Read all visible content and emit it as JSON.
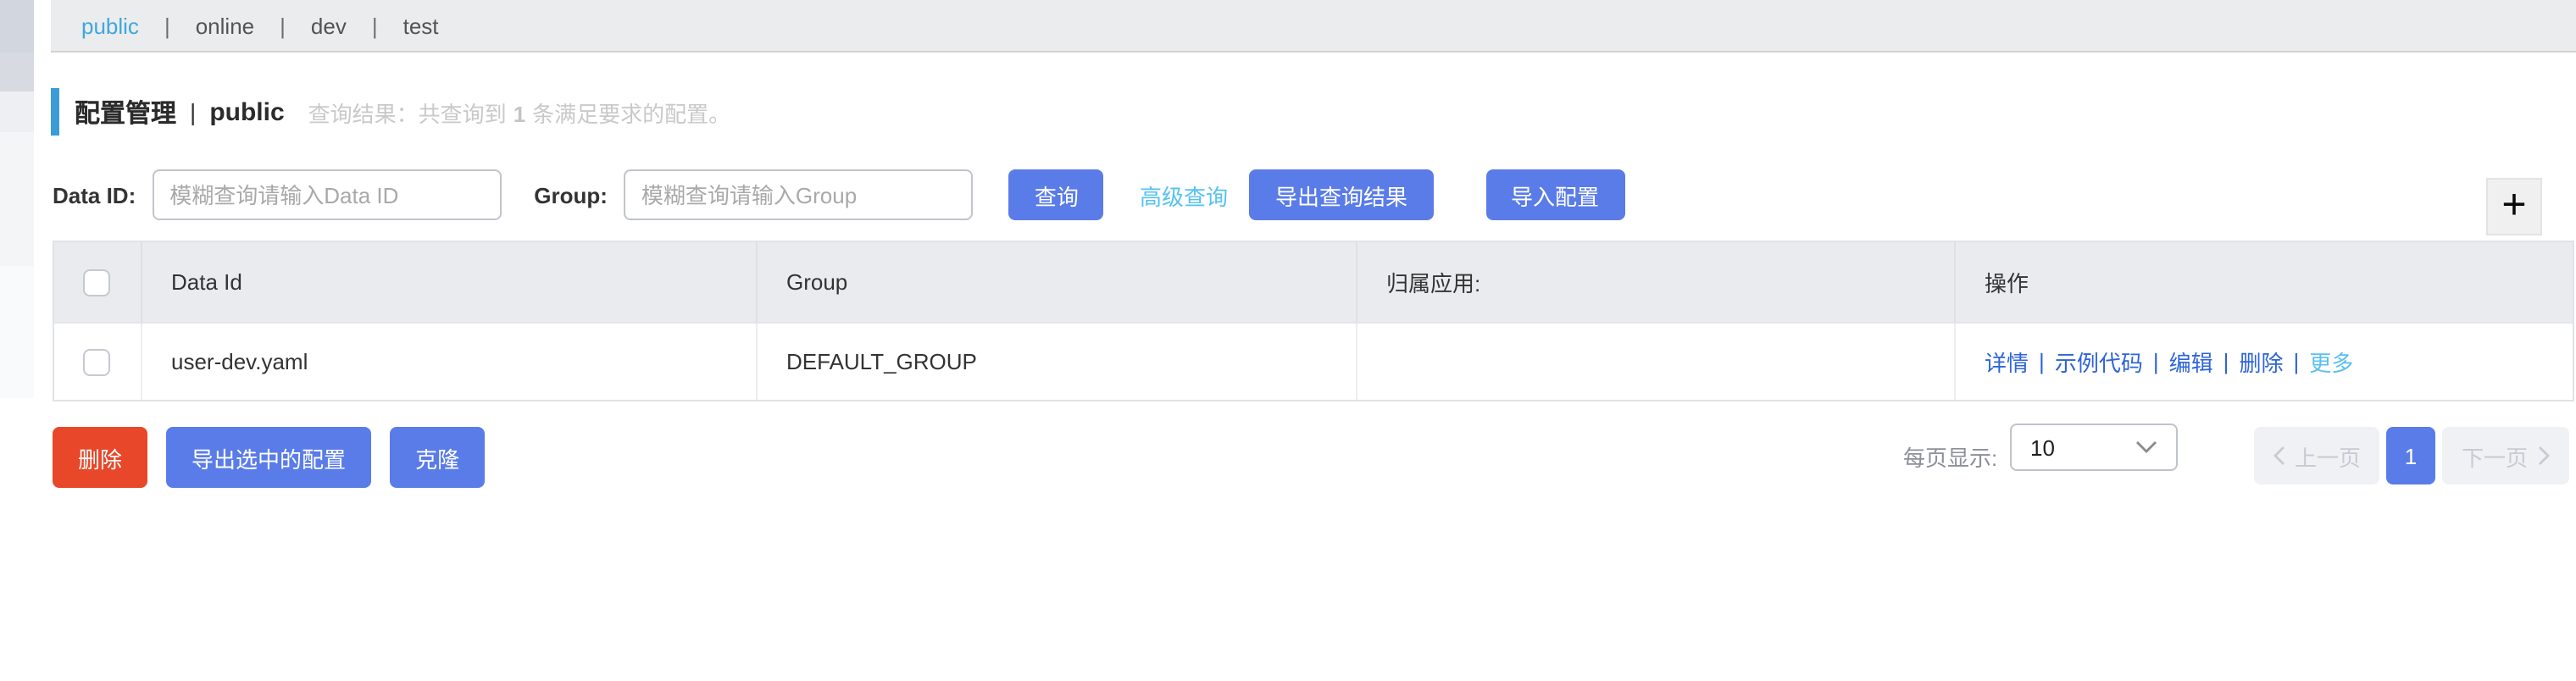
{
  "namespace_tabs": {
    "separator": "|",
    "items": [
      {
        "label": "public",
        "active": true
      },
      {
        "label": "online",
        "active": false
      },
      {
        "label": "dev",
        "active": false
      },
      {
        "label": "test",
        "active": false
      }
    ]
  },
  "header": {
    "title": "配置管理",
    "separator": "|",
    "namespace": "public",
    "result_prefix": "查询结果：共查询到",
    "result_count": "1",
    "result_suffix": "条满足要求的配置。"
  },
  "search_form": {
    "data_id_label": "Data ID:",
    "data_id_value": "",
    "data_id_placeholder": "模糊查询请输入Data ID",
    "group_label": "Group:",
    "group_value": "",
    "group_placeholder": "模糊查询请输入Group",
    "query_button": "查询",
    "advanced_query_link": "高级查询",
    "export_button": "导出查询结果",
    "import_button": "导入配置",
    "add_icon": "+"
  },
  "table": {
    "headers": [
      "",
      "Data Id",
      "Group",
      "归属应用:",
      "操作"
    ],
    "action_separator": "|",
    "rows": [
      {
        "data_id": "user-dev.yaml",
        "group": "DEFAULT_GROUP",
        "app": "",
        "actions": [
          "详情",
          "示例代码",
          "编辑",
          "删除",
          "更多"
        ]
      }
    ]
  },
  "footer": {
    "delete_button": "删除",
    "export_selected_button": "导出选中的配置",
    "clone_button": "克隆",
    "page_size_label": "每页显示:",
    "page_size_value": "10",
    "prev_button": "上一页",
    "current_page": "1",
    "next_button": "下一页"
  },
  "colors": {
    "primary_blue": "#5a7ce8",
    "danger_red": "#e8472a",
    "tab_active_cyan": "#3fa7dc",
    "accent_bar_cyan": "#3c9cd7",
    "light_link_cyan": "#56c1f0",
    "action_link_blue": "#2d64d8",
    "table_header_bg": "#e9ebee",
    "tabbar_bg": "#ebeced"
  }
}
